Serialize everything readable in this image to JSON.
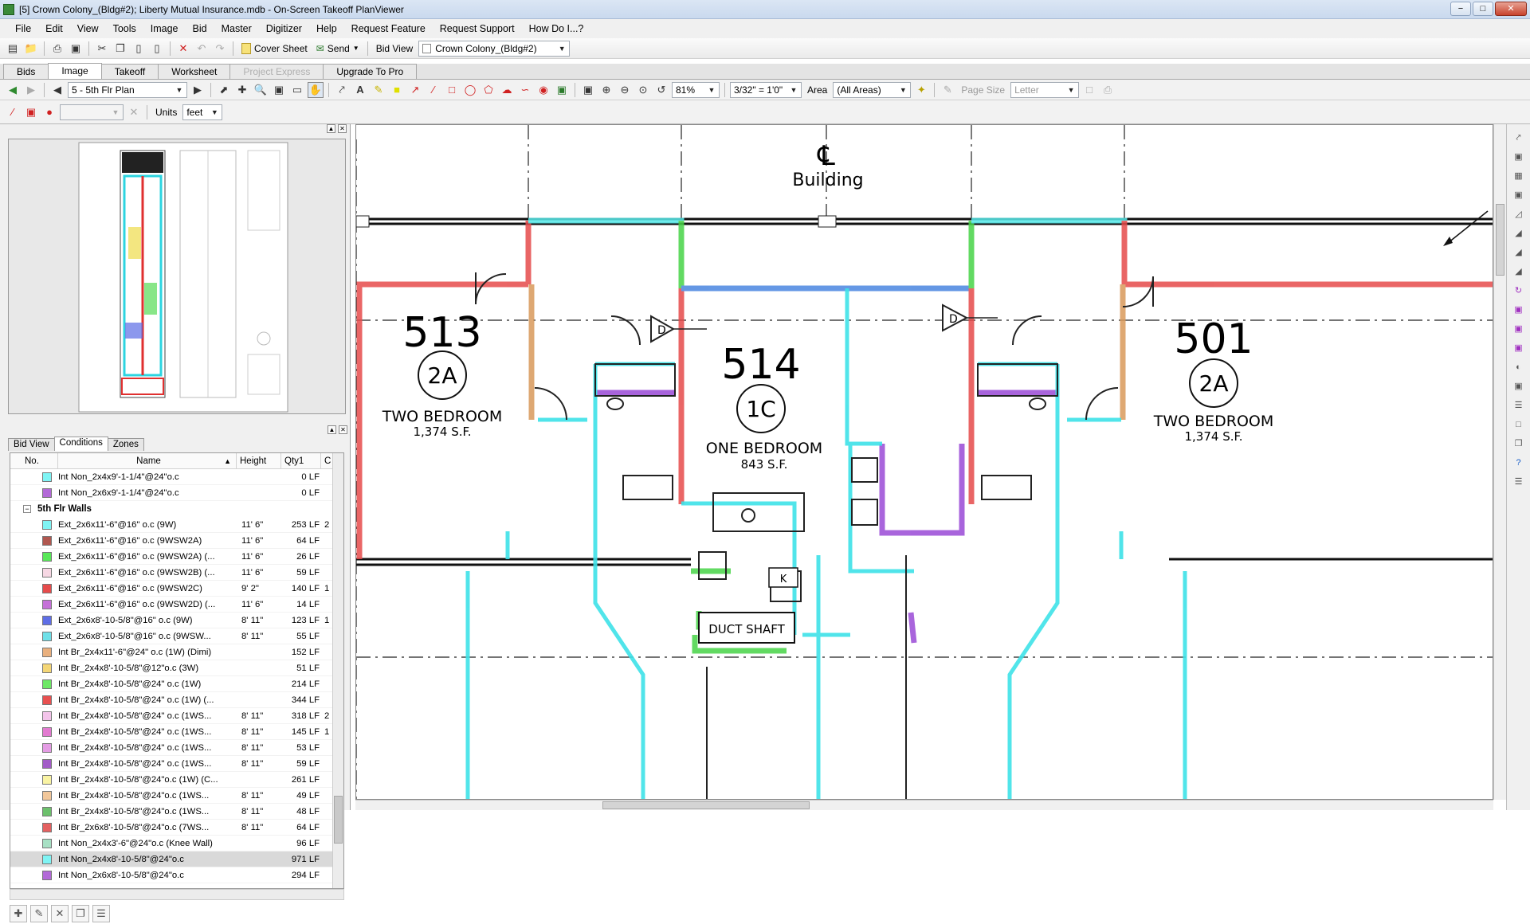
{
  "window": {
    "title": "[5] Crown Colony_(Bldg#2); Liberty Mutual Insurance.mdb - On-Screen Takeoff PlanViewer",
    "min": "−",
    "max": "□",
    "close": "✕"
  },
  "menu": [
    "File",
    "Edit",
    "View",
    "Tools",
    "Image",
    "Bid",
    "Master",
    "Digitizer",
    "Help",
    "Request Feature",
    "Request Support",
    "How Do I...?"
  ],
  "toolbar1": {
    "cover_sheet": "Cover Sheet",
    "send": "Send",
    "bid_view": "Bid View",
    "bid_combo": "Crown Colony_(Bldg#2)"
  },
  "tabs": [
    {
      "label": "Bids",
      "state": "normal"
    },
    {
      "label": "Image",
      "state": "active"
    },
    {
      "label": "Takeoff",
      "state": "normal"
    },
    {
      "label": "Worksheet",
      "state": "normal"
    },
    {
      "label": "Project Express",
      "state": "disabled"
    },
    {
      "label": "Upgrade To Pro",
      "state": "normal"
    }
  ],
  "toolbar2": {
    "page_combo": "5 - 5th Flr Plan",
    "zoom": "81%",
    "scale": "3/32\" = 1'0\"",
    "area_label": "Area",
    "area_combo": "(All Areas)",
    "page_size_label": "Page Size",
    "page_size_combo": "Letter"
  },
  "toolbar3": {
    "units_label": "Units",
    "units_combo": "feet"
  },
  "subtabs": [
    "Bid View",
    "Conditions",
    "Zones"
  ],
  "conditions": {
    "headers": {
      "no": "No.",
      "name": "Name",
      "height": "Height",
      "qty": "Qty1",
      "extra": "C"
    },
    "rows_before": [
      {
        "color": "#7ff4f4",
        "name": "Int Non_2x4x9'-1-1/4\"@24\"o.c",
        "height": "",
        "qty": "0 LF",
        "extra": ""
      },
      {
        "color": "#b36ad8",
        "name": "Int Non_2x6x9'-1-1/4\"@24\"o.c",
        "height": "",
        "qty": "0 LF",
        "extra": ""
      }
    ],
    "group": {
      "expander": "−",
      "label": "5th Flr Walls"
    },
    "rows": [
      {
        "color": "#7ff4f4",
        "name": "Ext_2x6x11'-6\"@16\" o.c (9W)",
        "height": "11' 6\"",
        "qty": "253 LF",
        "extra": "2"
      },
      {
        "color": "#b0574f",
        "name": "Ext_2x6x11'-6\"@16\" o.c (9WSW2A)",
        "height": "11' 6\"",
        "qty": "64 LF",
        "extra": ""
      },
      {
        "color": "#58e858",
        "name": "Ext_2x6x11'-6\"@16\" o.c (9WSW2A) (...",
        "height": "11' 6\"",
        "qty": "26 LF",
        "extra": ""
      },
      {
        "color": "#f7d8e4",
        "name": "Ext_2x6x11'-6\"@16\" o.c (9WSW2B) (...",
        "height": "11' 6\"",
        "qty": "59 LF",
        "extra": ""
      },
      {
        "color": "#e64b4b",
        "name": "Ext_2x6x11'-6\"@16\" o.c (9WSW2C)",
        "height": "9' 2\"",
        "qty": "140 LF",
        "extra": "1"
      },
      {
        "color": "#c571d8",
        "name": "Ext_2x6x11'-6\"@16\" o.c (9WSW2D) (...",
        "height": "11' 6\"",
        "qty": "14 LF",
        "extra": ""
      },
      {
        "color": "#5e6ee6",
        "name": "Ext_2x6x8'-10-5/8\"@16\" o.c (9W)",
        "height": "8' 11\"",
        "qty": "123 LF",
        "extra": "1"
      },
      {
        "color": "#6fe0e8",
        "name": "Ext_2x6x8'-10-5/8\"@16\" o.c (9WSW...",
        "height": "8' 11\"",
        "qty": "55 LF",
        "extra": ""
      },
      {
        "color": "#e9b07e",
        "name": "Int Br_2x4x11'-6\"@24\" o.c (1W) (Dimi)",
        "height": "",
        "qty": "152 LF",
        "extra": ""
      },
      {
        "color": "#f4d676",
        "name": "Int Br_2x4x8'-10-5/8\"@12\"o.c (3W)",
        "height": "",
        "qty": "51 LF",
        "extra": ""
      },
      {
        "color": "#6ee866",
        "name": "Int Br_2x4x8'-10-5/8\"@24\" o.c (1W)",
        "height": "",
        "qty": "214 LF",
        "extra": ""
      },
      {
        "color": "#e85050",
        "name": "Int Br_2x4x8'-10-5/8\"@24\" o.c (1W) (...",
        "height": "",
        "qty": "344 LF",
        "extra": ""
      },
      {
        "color": "#f3c4ea",
        "name": "Int Br_2x4x8'-10-5/8\"@24\" o.c (1WS...",
        "height": "8' 11\"",
        "qty": "318 LF",
        "extra": "2"
      },
      {
        "color": "#e27ad0",
        "name": "Int Br_2x4x8'-10-5/8\"@24\" o.c (1WS...",
        "height": "8' 11\"",
        "qty": "145 LF",
        "extra": "1"
      },
      {
        "color": "#e49ce4",
        "name": "Int Br_2x4x8'-10-5/8\"@24\" o.c (1WS...",
        "height": "8' 11\"",
        "qty": "53 LF",
        "extra": ""
      },
      {
        "color": "#a35dc8",
        "name": "Int Br_2x4x8'-10-5/8\"@24\" o.c (1WS...",
        "height": "8' 11\"",
        "qty": "59 LF",
        "extra": ""
      },
      {
        "color": "#f9f3a3",
        "name": "Int Br_2x4x8'-10-5/8\"@24\"o.c (1W) (C...",
        "height": "",
        "qty": "261 LF",
        "extra": ""
      },
      {
        "color": "#f2c79a",
        "name": "Int Br_2x4x8'-10-5/8\"@24\"o.c (1WS...",
        "height": "8' 11\"",
        "qty": "49 LF",
        "extra": ""
      },
      {
        "color": "#6cc06c",
        "name": "Int Br_2x4x8'-10-5/8\"@24\"o.c (1WS...",
        "height": "8' 11\"",
        "qty": "48 LF",
        "extra": ""
      },
      {
        "color": "#e46060",
        "name": "Int Br_2x6x8'-10-5/8\"@24\"o.c (7WS...",
        "height": "8' 11\"",
        "qty": "64 LF",
        "extra": ""
      },
      {
        "color": "#a7e0c4",
        "name": "Int Non_2x4x3'-6\"@24\"o.c (Knee Wall)",
        "height": "",
        "qty": "96 LF",
        "extra": ""
      },
      {
        "color": "#7ff4f4",
        "name": "Int Non_2x4x8'-10-5/8\"@24\"o.c",
        "height": "",
        "qty": "971 LF",
        "extra": "",
        "selected": true
      },
      {
        "color": "#b36ad8",
        "name": "Int Non_2x6x8'-10-5/8\"@24\"o.c",
        "height": "",
        "qty": "294 LF",
        "extra": ""
      }
    ]
  },
  "plan": {
    "centerline_mark": "℄",
    "building_label": "Building",
    "units": [
      {
        "number": "513",
        "type": "2A",
        "name": "TWO BEDROOM",
        "area": "1,374 S.F."
      },
      {
        "number": "514",
        "type": "1C",
        "name": "ONE BEDROOM",
        "area": "843 S.F."
      },
      {
        "number": "501",
        "type": "2A",
        "name": "TWO BEDROOM",
        "area": "1,374 S.F."
      }
    ],
    "duct_shaft": "DUCT SHAFT",
    "door_tag": "D",
    "k_tag": "K"
  }
}
